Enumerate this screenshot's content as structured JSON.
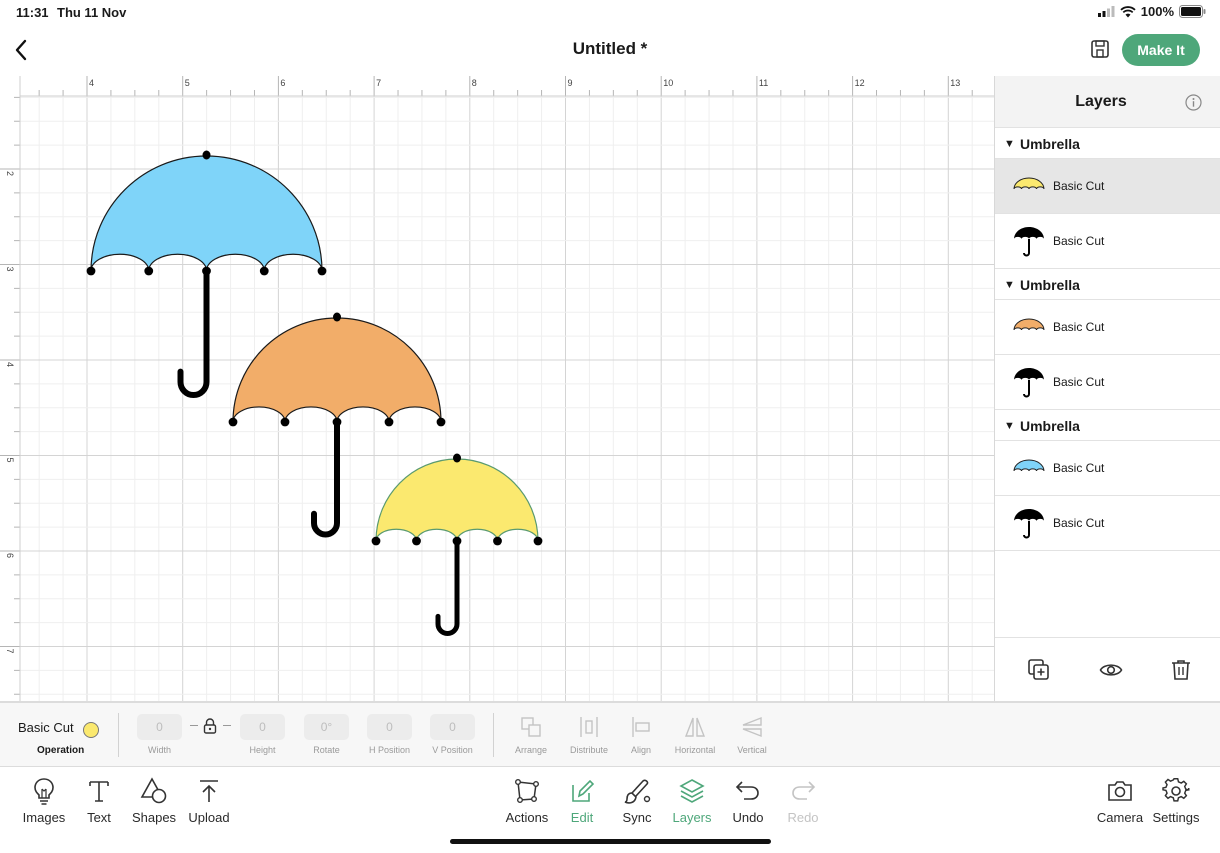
{
  "status_bar": {
    "time": "11:31",
    "date": "Thu 11 Nov",
    "battery": "100%"
  },
  "header": {
    "title": "Untitled *",
    "make_it_label": "Make It"
  },
  "canvas": {
    "ruler_top": [
      "4",
      "5",
      "6",
      "7",
      "8",
      "9",
      "10",
      "11",
      "12",
      "13"
    ],
    "ruler_left": [
      "2",
      "3",
      "4",
      "5",
      "6",
      "7"
    ],
    "objects": [
      {
        "name": "Umbrella",
        "canopy_color": "#7fd4f9"
      },
      {
        "name": "Umbrella",
        "canopy_color": "#f2ad69"
      },
      {
        "name": "Umbrella",
        "canopy_color": "#fbe96f"
      }
    ]
  },
  "layers": {
    "title": "Layers",
    "groups": [
      {
        "name": "Umbrella",
        "items": [
          {
            "label": "Basic Cut",
            "color": "#fbe96f",
            "selected": true
          },
          {
            "label": "Basic Cut",
            "color": "#000000"
          }
        ]
      },
      {
        "name": "Umbrella",
        "items": [
          {
            "label": "Basic Cut",
            "color": "#f2ad69"
          },
          {
            "label": "Basic Cut",
            "color": "#000000"
          }
        ]
      },
      {
        "name": "Umbrella",
        "items": [
          {
            "label": "Basic Cut",
            "color": "#7fd4f9"
          },
          {
            "label": "Basic Cut",
            "color": "#000000"
          }
        ]
      }
    ]
  },
  "edit_bar": {
    "operation": "Basic Cut",
    "operation_caption": "Operation",
    "width": {
      "value": "0",
      "label": "Width"
    },
    "height": {
      "value": "0",
      "label": "Height"
    },
    "rotate": {
      "value": "0°",
      "label": "Rotate"
    },
    "h_position": {
      "value": "0",
      "label": "H Position"
    },
    "v_position": {
      "value": "0",
      "label": "V Position"
    },
    "tools": [
      "Arrange",
      "Distribute",
      "Align",
      "Horizontal",
      "Vertical"
    ]
  },
  "toolbar": {
    "left": [
      "Images",
      "Text",
      "Shapes",
      "Upload"
    ],
    "center": [
      "Actions",
      "Edit",
      "Sync",
      "Layers",
      "Undo",
      "Redo"
    ],
    "right": [
      "Camera",
      "Settings"
    ]
  },
  "colors": {
    "accent": "#4ea77a"
  }
}
